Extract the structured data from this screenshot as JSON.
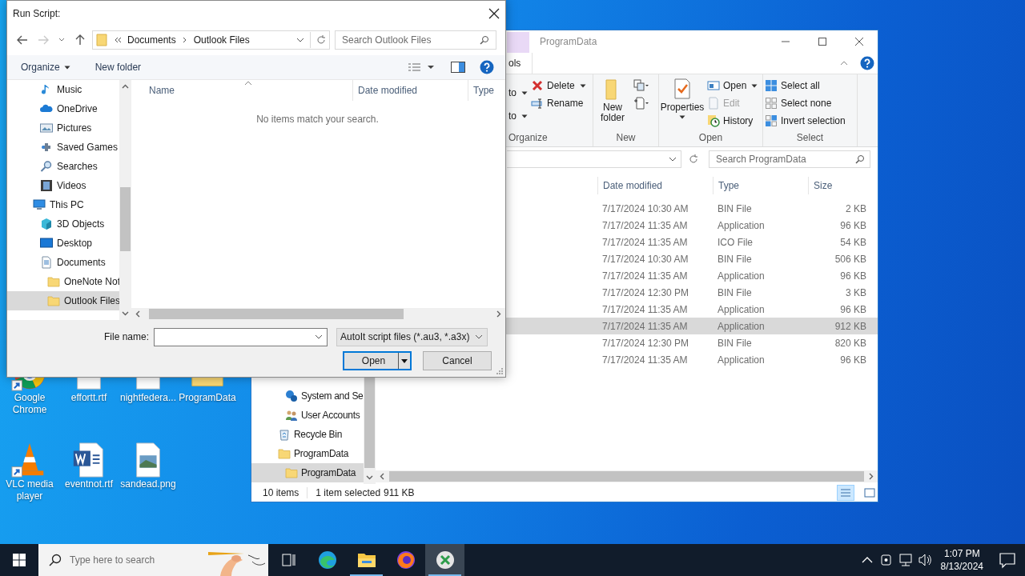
{
  "desktop_icons": [
    {
      "label": "Google Chrome",
      "shortcut": true
    },
    {
      "label": "effortt.rtf",
      "shortcut": false
    },
    {
      "label": "nightfedera...",
      "shortcut": false
    },
    {
      "label": "ProgramData",
      "shortcut": false
    },
    {
      "label": "VLC media player",
      "shortcut": true
    },
    {
      "label": "eventnot.rtf",
      "shortcut": false
    },
    {
      "label": "sandead.png",
      "shortcut": false
    }
  ],
  "explorer": {
    "title": "ProgramData",
    "ribbon_tab": "ols",
    "ribbon": {
      "organize": {
        "label": "Organize",
        "partial_1": "to",
        "partial_2": "to",
        "delete": "Delete",
        "rename": "Rename"
      },
      "new": {
        "label": "New",
        "new_folder": "New folder"
      },
      "open": {
        "label": "Open",
        "properties": "Properties",
        "open": "Open",
        "edit": {
          "label": "Edit",
          "disabled": true
        },
        "history": "History"
      },
      "select": {
        "label": "Select",
        "select_all": "Select all",
        "select_none": "Select none",
        "invert": "Invert selection"
      }
    },
    "search": {
      "placeholder": "Search ProgramData"
    },
    "columns": [
      "Date modified",
      "Type",
      "Size"
    ],
    "rows": [
      {
        "date": "7/17/2024 10:30 AM",
        "type": "BIN File",
        "size": "2 KB",
        "selected": false
      },
      {
        "date": "7/17/2024 11:35 AM",
        "type": "Application",
        "size": "96 KB",
        "selected": false
      },
      {
        "date": "7/17/2024 11:35 AM",
        "type": "ICO File",
        "size": "54 KB",
        "selected": false
      },
      {
        "date": "7/17/2024 10:30 AM",
        "type": "BIN File",
        "size": "506 KB",
        "selected": false
      },
      {
        "date": "7/17/2024 11:35 AM",
        "type": "Application",
        "size": "96 KB",
        "selected": false
      },
      {
        "date": "7/17/2024 12:30 PM",
        "type": "BIN File",
        "size": "3 KB",
        "selected": false
      },
      {
        "date": "7/17/2024 11:35 AM",
        "type": "Application",
        "size": "96 KB",
        "selected": false
      },
      {
        "date": "7/17/2024 11:35 AM",
        "type": "Application",
        "size": "912 KB",
        "selected": true
      },
      {
        "date": "7/17/2024 12:30 PM",
        "type": "BIN File",
        "size": "820 KB",
        "selected": false
      },
      {
        "date": "7/17/2024 11:35 AM",
        "type": "Application",
        "size": "96 KB",
        "selected": false
      }
    ],
    "nav_pane": {
      "continued_children": [
        {
          "label": "System and Se",
          "selected": false
        },
        {
          "label": "User Accounts",
          "selected": false
        }
      ],
      "items": [
        {
          "label": "Recycle Bin",
          "selected": false
        },
        {
          "label": "ProgramData",
          "selected": false,
          "children": [
            {
              "label": "ProgramData",
              "selected": true
            }
          ]
        }
      ]
    },
    "status": {
      "count": "10 items",
      "selection": "1 item selected",
      "selection_size": "911 KB"
    }
  },
  "dialog": {
    "title": "Run Script:",
    "forward_disabled": true,
    "breadcrumb": [
      "Documents",
      "Outlook Files"
    ],
    "search": {
      "placeholder": "Search Outlook Files"
    },
    "toolbar": {
      "organize": "Organize",
      "new_folder": "New folder"
    },
    "tree": {
      "continued_children": [
        {
          "label": "Music",
          "selected": false
        },
        {
          "label": "OneDrive",
          "selected": false
        },
        {
          "label": "Pictures",
          "selected": false
        },
        {
          "label": "Saved Games",
          "selected": false
        },
        {
          "label": "Searches",
          "selected": false
        },
        {
          "label": "Videos",
          "selected": false
        }
      ],
      "items": [
        {
          "label": "This PC",
          "selected": false,
          "children": [
            {
              "label": "3D Objects",
              "selected": false
            },
            {
              "label": "Desktop",
              "selected": false
            },
            {
              "label": "Documents",
              "selected": false,
              "children": [
                {
                  "label": "OneNote Not",
                  "selected": false
                },
                {
                  "label": "Outlook Files",
                  "selected": true
                }
              ]
            }
          ]
        }
      ]
    },
    "columns": [
      "Name",
      "Date modified",
      "Type"
    ],
    "empty_message": "No items match your search.",
    "file_name_label": "File name:",
    "filter": "AutoIt script files (*.au3, *.a3x)",
    "buttons": {
      "open": "Open",
      "cancel": "Cancel"
    }
  },
  "taskbar": {
    "search_placeholder": "Type here to search",
    "apps": [
      {
        "running": false,
        "active": false
      },
      {
        "running": true,
        "active": false
      },
      {
        "running": false,
        "active": false
      },
      {
        "running": true,
        "active": true
      }
    ],
    "time": "1:07 PM",
    "date": "8/13/2024"
  }
}
